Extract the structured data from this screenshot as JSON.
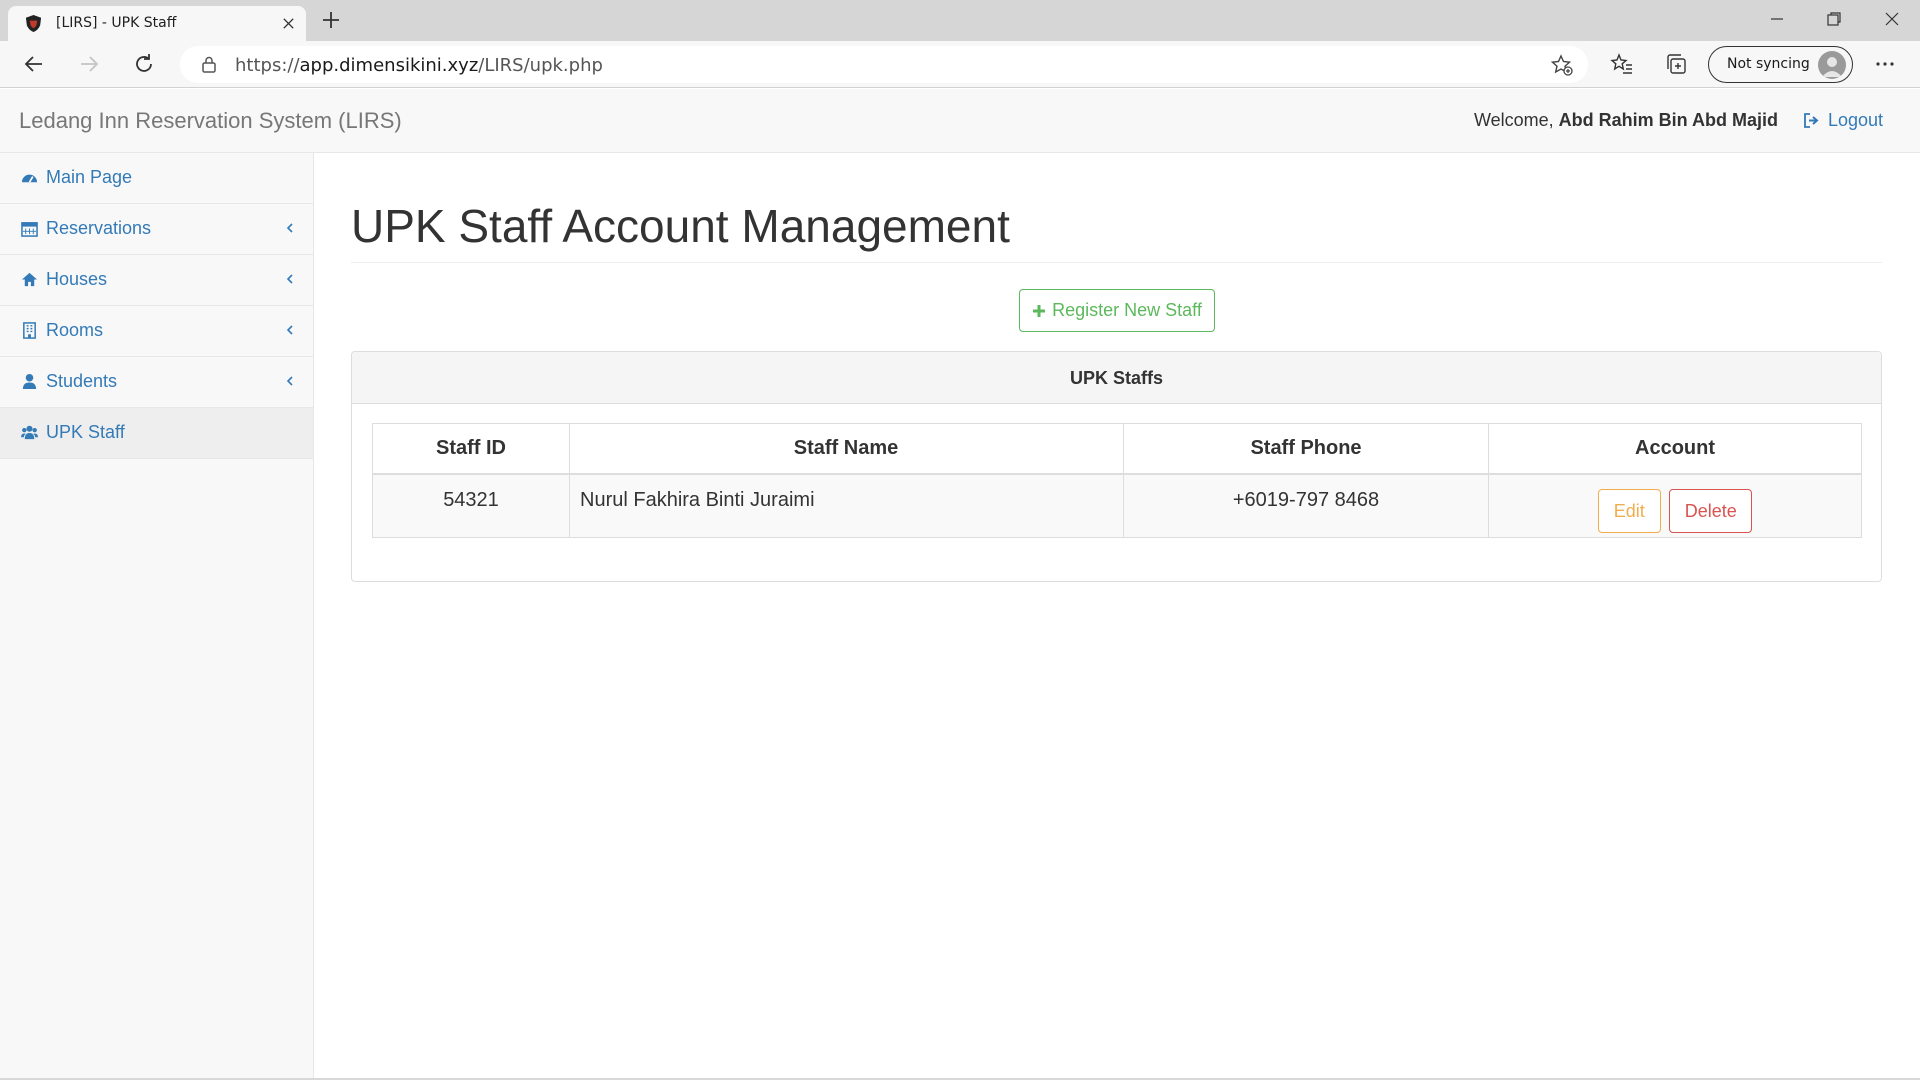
{
  "browser": {
    "tab_title": "[LIRS] - UPK Staff",
    "url_prefix": "https://",
    "url_host": "app.dimensikini.xyz",
    "url_path": "/LIRS/upk.php",
    "sync_label": "Not syncing"
  },
  "navbar": {
    "brand": "Ledang Inn Reservation System (LIRS)",
    "welcome_prefix": "Welcome,",
    "user_name": "Abd Rahim Bin Abd Majid",
    "logout_label": "Logout"
  },
  "sidebar": {
    "items": [
      {
        "label": "Main Page",
        "icon": "dashboard-icon"
      },
      {
        "label": "Reservations",
        "icon": "calendar-icon"
      },
      {
        "label": "Houses",
        "icon": "home-icon"
      },
      {
        "label": "Rooms",
        "icon": "building-icon"
      },
      {
        "label": "Students",
        "icon": "user-icon"
      },
      {
        "label": "UPK Staff",
        "icon": "users-icon"
      }
    ]
  },
  "main": {
    "page_title": "UPK Staff Account Management",
    "register_button": "Register New Staff",
    "panel_heading": "UPK Staffs",
    "table": {
      "headers": [
        "Staff ID",
        "Staff Name",
        "Staff Phone",
        "Account"
      ],
      "rows": [
        {
          "id": "54321",
          "name": "Nurul Fakhira Binti Juraimi",
          "phone": "+6019-797 8468"
        }
      ],
      "edit_label": "Edit",
      "delete_label": "Delete"
    }
  },
  "colors": {
    "link": "#337ab7",
    "success": "#5cb85c",
    "warning": "#f0ad4e",
    "danger": "#d9534f"
  }
}
